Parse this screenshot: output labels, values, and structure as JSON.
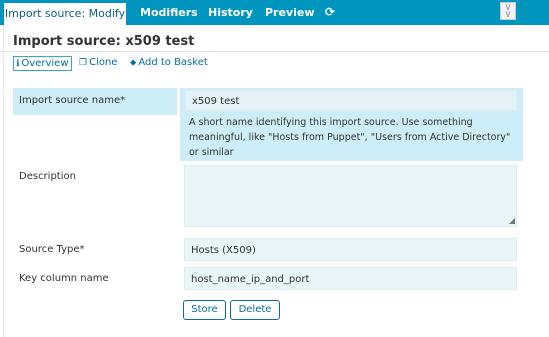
{
  "tabs": {
    "active": "Import source: Modify",
    "modifiers": "Modifiers",
    "history": "History",
    "preview": "Preview",
    "refresh_icon": "refresh-icon",
    "collapse_icon": "collapse-icon"
  },
  "page": {
    "title": "Import source: x509 test"
  },
  "actions": {
    "overview": "Overview",
    "clone": "Clone",
    "add_to_basket": "Add to Basket"
  },
  "form": {
    "name_label": "Import source name*",
    "name_value": "x509 test",
    "name_hint": "A short name identifying this import source. Use something meaningful, like \"Hosts from Puppet\", \"Users from Active Directory\" or similar",
    "description_label": "Description",
    "description_value": "",
    "source_type_label": "Source Type*",
    "source_type_value": "Hosts (X509)",
    "key_column_label": "Key column name",
    "key_column_value": "host_name_ip_and_port",
    "store_label": "Store",
    "delete_label": "Delete"
  },
  "colors": {
    "tab_bar": "#0095bf",
    "highlight": "#cdeef8",
    "link": "#0b6d9a"
  }
}
